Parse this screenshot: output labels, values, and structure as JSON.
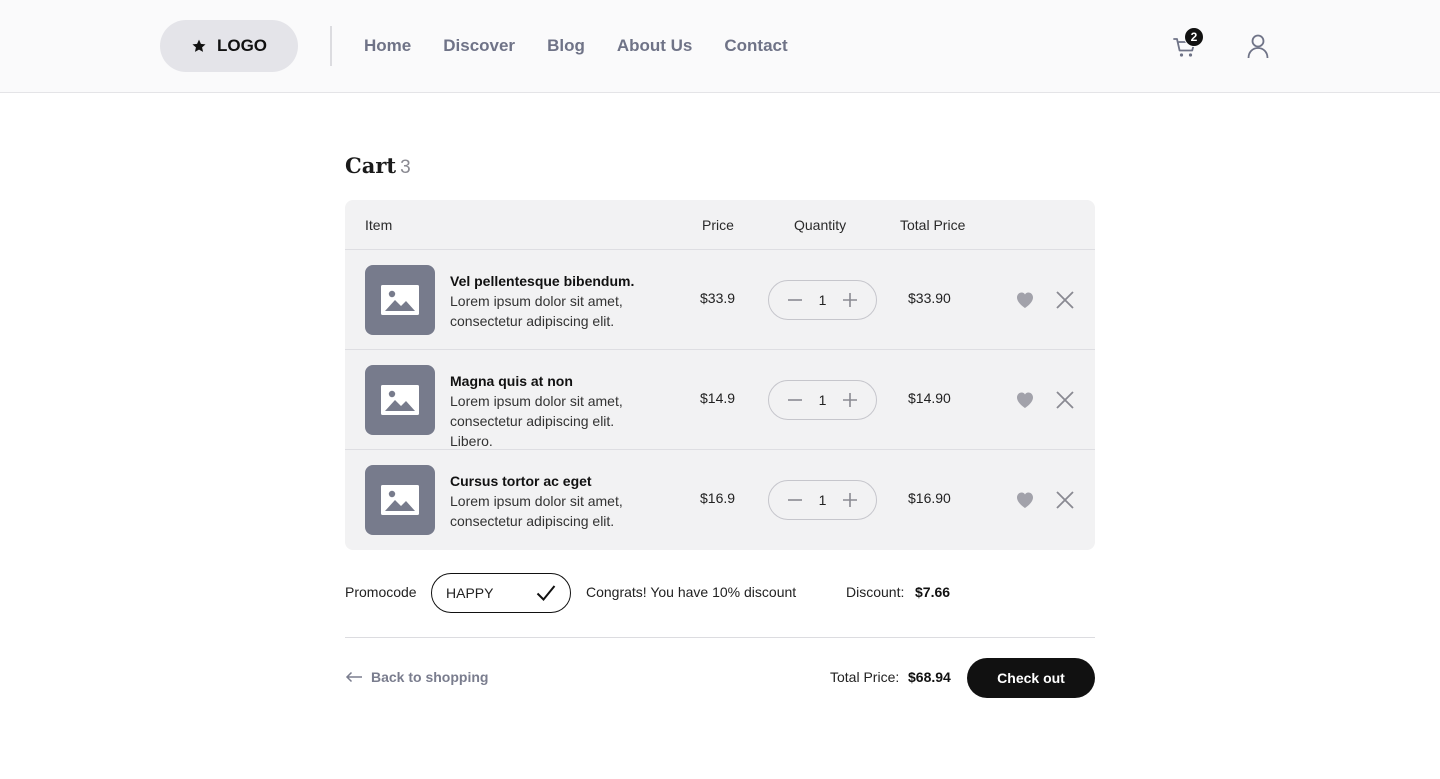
{
  "header": {
    "logo_label": "LOGO",
    "logo_icon": "star-icon",
    "nav": [
      {
        "label": "Home"
      },
      {
        "label": "Discover"
      },
      {
        "label": "Blog"
      },
      {
        "label": "About Us"
      },
      {
        "label": "Contact"
      }
    ],
    "cart_badge": "2",
    "cart_icon": "cart-icon",
    "user_icon": "user-icon"
  },
  "cart": {
    "title": "Cart",
    "count": "3",
    "columns": {
      "item": "Item",
      "price": "Price",
      "quantity": "Quantity",
      "total": "Total Price"
    },
    "items": [
      {
        "name": "Vel pellentesque bibendum.",
        "description": "Lorem ipsum dolor sit amet, consectetur adipiscing elit.",
        "price": "$33.9",
        "quantity": "1",
        "total": "$33.90"
      },
      {
        "name": "Magna quis at non",
        "description": "Lorem ipsum dolor sit amet, consectetur adipiscing elit. Libero.",
        "price": "$14.9",
        "quantity": "1",
        "total": "$14.90"
      },
      {
        "name": "Cursus tortor ac eget",
        "description": "Lorem ipsum dolor sit amet, consectetur adipiscing elit.",
        "price": "$16.9",
        "quantity": "1",
        "total": "$16.90"
      }
    ]
  },
  "promo": {
    "label": "Promocode",
    "value": "HAPPY",
    "message": "Congrats! You have 10% discount",
    "discount_label": "Discount:",
    "discount_value": "$7.66"
  },
  "footer": {
    "back_label": "Back to shopping",
    "total_label": "Total Price:",
    "total_value": "$68.94",
    "checkout_label": "Check out"
  },
  "colors": {
    "accent": "#111111",
    "muted_text": "#6f7387",
    "thumb_bg": "#777b8c",
    "table_bg": "#f2f2f3",
    "header_bg": "#fafafb"
  }
}
